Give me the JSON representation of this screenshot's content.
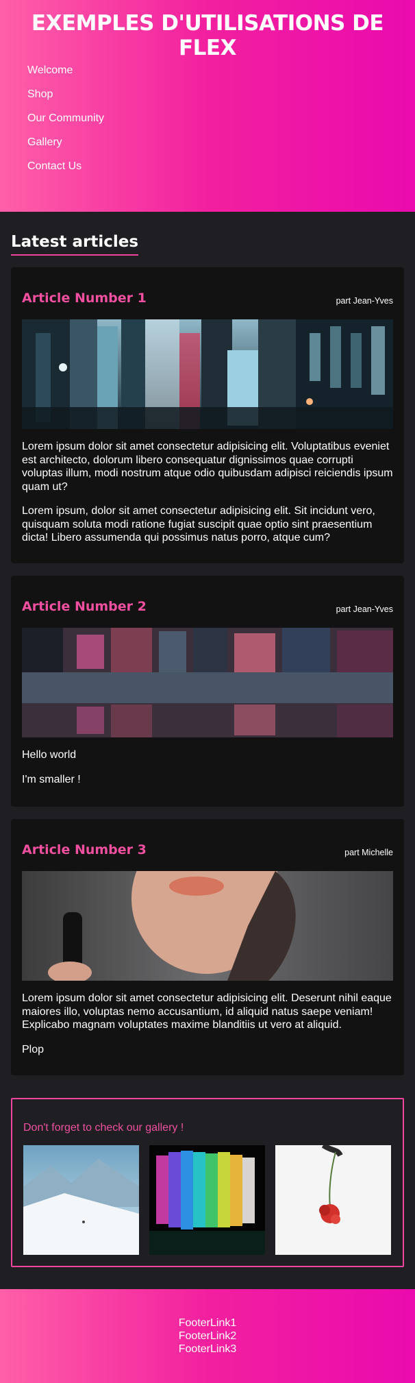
{
  "header": {
    "title": "EXEMPLES D'UTILISATIONS DE FLEX",
    "nav": [
      "Welcome",
      "Shop",
      "Our Community",
      "Gallery",
      "Contact Us"
    ]
  },
  "section": {
    "title": "Latest articles"
  },
  "articles": [
    {
      "title": "Article Number 1",
      "author": "part Jean-Yves",
      "image": "city-street-night-photo",
      "paragraphs": [
        "Lorem ipsum dolor sit amet consectetur adipisicing elit. Voluptatibus eveniet est architecto, dolorum libero consequatur dignissimos quae corrupti voluptas illum, modi nostrum atque odio quibusdam adipisci reiciendis ipsum quam ut?",
        "Lorem ipsum, dolor sit amet consectetur adipisicing elit. Sit incidunt vero, quisquam soluta modi ratione fugiat suscipit quae optio sint praesentium dicta! Libero assumenda qui possimus natus porro, atque cum?"
      ]
    },
    {
      "title": "Article Number 2",
      "author": "part Jean-Yves",
      "image": "street-puddle-reflection-photo",
      "paragraphs": [
        "Hello world",
        "I'm smaller !"
      ]
    },
    {
      "title": "Article Number 3",
      "author": "part Michelle",
      "image": "woman-portrait-photo",
      "paragraphs": [
        "Lorem ipsum dolor sit amet consectetur adipisicing elit. Deserunt nihil eaque maiores illo, voluptas nemo accusantium, id aliquid natus saepe veniam! Explicabo magnam voluptates maxime blanditiis ut vero at aliquid.",
        "Plop"
      ]
    }
  ],
  "gallery": {
    "title": "Don't forget to check our gallery !",
    "images": [
      "snowy-mountain-photo",
      "rainbow-fabric-photo",
      "red-flower-photo"
    ]
  },
  "footer": {
    "links": [
      "FooterLink1",
      "FooterLink2",
      "FooterLink3"
    ]
  },
  "colors": {
    "accent": "#f0449e",
    "background": "#1f1f23",
    "card": "#121212"
  }
}
